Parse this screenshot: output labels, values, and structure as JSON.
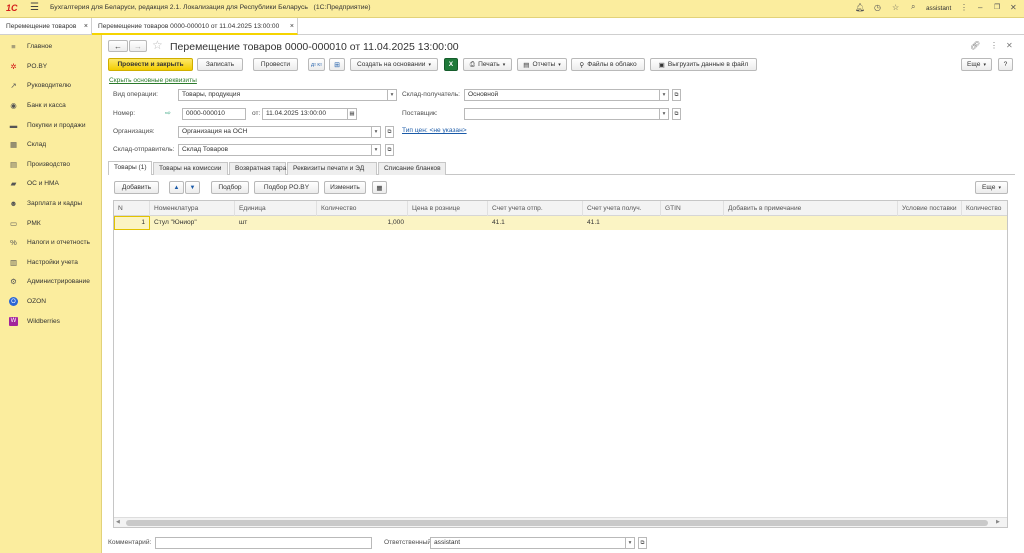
{
  "app_title": "Бухгалтерия для Беларуси, редакция 2.1. Локализация для Республики Беларусь   (1С:Предприятие)",
  "user": "assistant",
  "window_tabs": [
    {
      "label": "Перемещение товаров",
      "close": "×"
    },
    {
      "label": "Перемещение товаров 0000-000010 от 11.04.2025 13:00:00",
      "close": "×"
    }
  ],
  "sidebar": {
    "items": [
      {
        "label": "Главное",
        "icon": "≡"
      },
      {
        "label": "PO.BY",
        "icon": "✲"
      },
      {
        "label": "Руководителю",
        "icon": "↗"
      },
      {
        "label": "Банк и касса",
        "icon": "◉"
      },
      {
        "label": "Покупки и продажи",
        "icon": "▬"
      },
      {
        "label": "Склад",
        "icon": "▦"
      },
      {
        "label": "Производство",
        "icon": "▤"
      },
      {
        "label": "ОС и НМА",
        "icon": "▰"
      },
      {
        "label": "Зарплата и кадры",
        "icon": "☻"
      },
      {
        "label": "РМК",
        "icon": "▭"
      },
      {
        "label": "Налоги и отчетность",
        "icon": "%"
      },
      {
        "label": "Настройки учета",
        "icon": "▥"
      },
      {
        "label": "Администрирование",
        "icon": "⚙"
      },
      {
        "label": "OZON",
        "icon": "O"
      },
      {
        "label": "Wildberries",
        "icon": "W"
      }
    ]
  },
  "doc": {
    "title": "Перемещение товаров 0000-000010 от 11.04.2025 13:00:00",
    "toolbar": {
      "post_close": "Провести и закрыть",
      "save": "Записать",
      "post": "Провести",
      "dt_kt": "Дт Кт",
      "create_based": "Создать на основании",
      "excel": "X",
      "print": "Печать",
      "reports": "Отчеты",
      "files_cloud": "Файлы в облако",
      "export_file": "Выгрузить данные в файл",
      "more": "Еще",
      "help": "?"
    },
    "hide_link": "Скрыть основные реквизиты",
    "fields": {
      "operation_label": "Вид операции:",
      "operation_value": "Товары, продукция",
      "number_label": "Номер:",
      "number_value": "0000-000010",
      "date_from_label": "от:",
      "date_value": "11.04.2025 13:00:00",
      "org_label": "Организация:",
      "org_value": "Организация на ОСН",
      "sender_label": "Склад-отправитель:",
      "sender_value": "Склад Товаров",
      "receiver_label": "Склад-получатель:",
      "receiver_value": "Основной",
      "supplier_label": "Поставщик:",
      "supplier_value": "",
      "price_type_link": "Тип цен: <не указан>"
    },
    "form_tabs": [
      "Товары (1)",
      "Товары на комиссии",
      "Возвратная тара",
      "Реквизиты печати и ЭД",
      "Списание бланков"
    ],
    "table_toolbar": {
      "add": "Добавить",
      "up": "▲",
      "down": "▼",
      "select": "Подбор",
      "select_poby": "Подбор PO.BY",
      "change": "Изменить",
      "more": "Еще"
    },
    "table": {
      "columns": [
        "N",
        "Номенклатура",
        "Единица",
        "Количество",
        "Цена в рознице",
        "Счет учета отпр.",
        "Счет учета получ.",
        "GTIN",
        "Добавить в примечание",
        "Условие поставки",
        "Количество"
      ],
      "rows": [
        [
          "1",
          "Стул \"Юниор\"",
          "шт",
          "1,000",
          "",
          "41.1",
          "41.1",
          "",
          "",
          "",
          ""
        ]
      ]
    },
    "footer": {
      "comment_label": "Комментарий:",
      "comment_value": "",
      "responsible_label": "Ответственный:",
      "responsible_value": "assistant"
    }
  },
  "colors": {
    "accent_yellow": "#fbed9e",
    "button_yellow": "#f5d400",
    "selected_row": "#fbf4c4",
    "link_blue": "#1a5aa8"
  }
}
